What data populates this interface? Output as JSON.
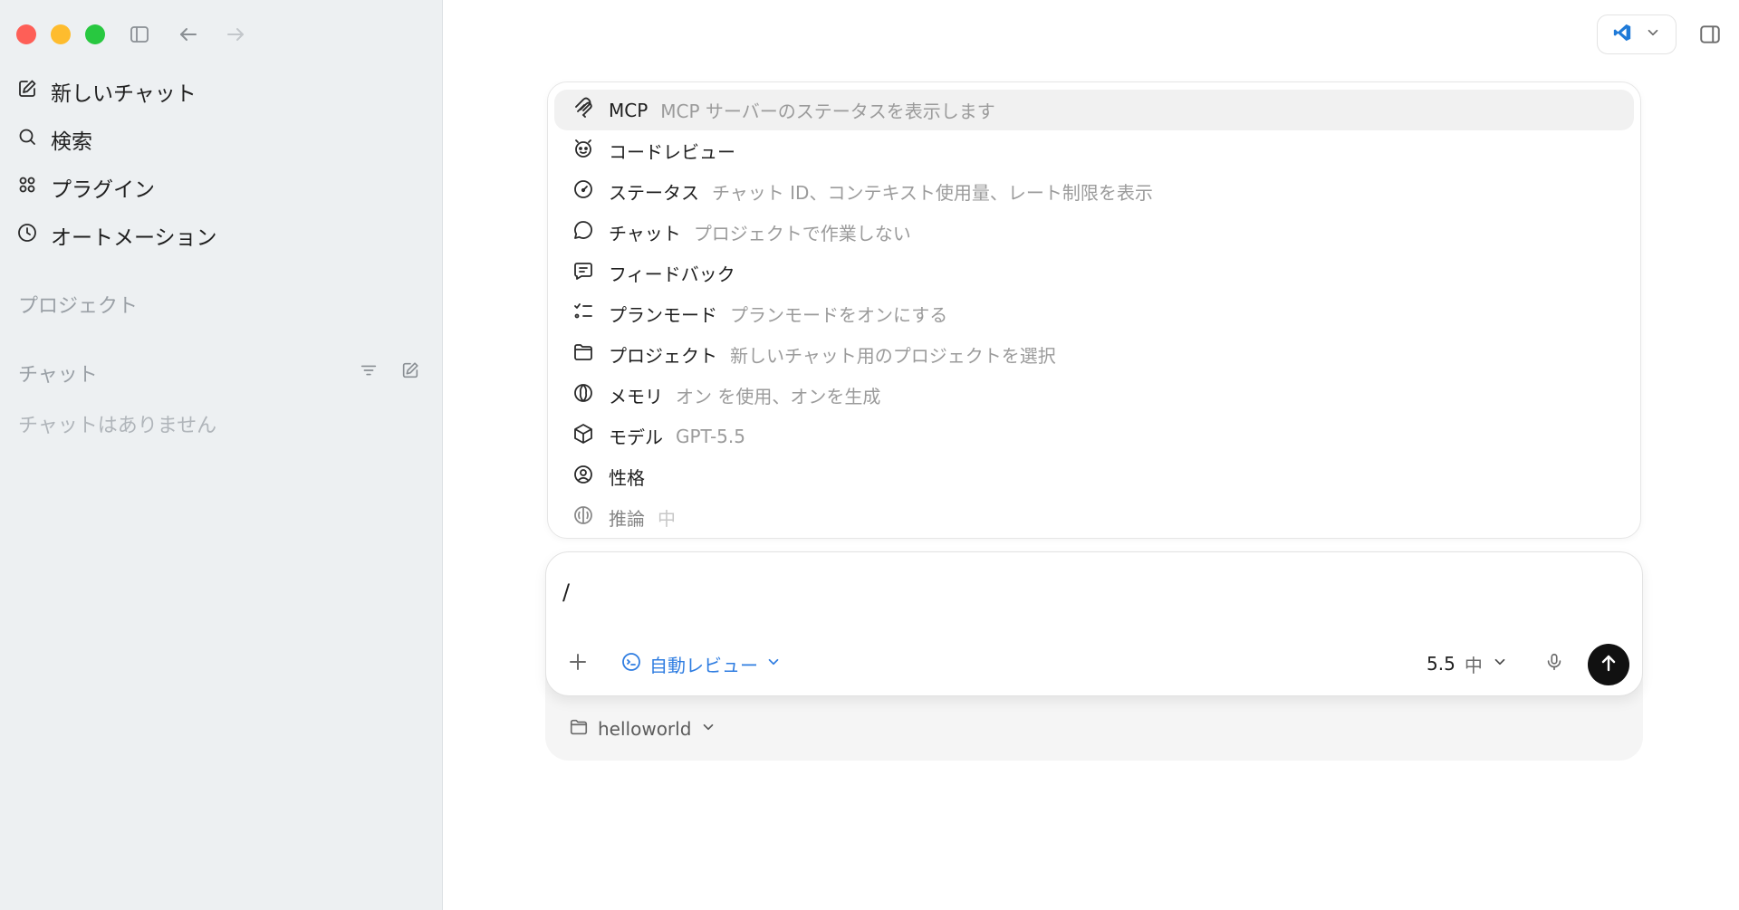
{
  "colors": {
    "sidebar_bg": "#edf0f2",
    "accent_blue": "#2f7de1",
    "traffic_red": "#fe5f57",
    "traffic_yellow": "#febc2e",
    "traffic_green": "#28c840",
    "send_button": "#111111"
  },
  "sidebar": {
    "nav": [
      {
        "label": "新しいチャット",
        "icon": "new-chat-icon"
      },
      {
        "label": "検索",
        "icon": "search-icon"
      },
      {
        "label": "プラグイン",
        "icon": "plugins-icon"
      },
      {
        "label": "オートメーション",
        "icon": "clock-icon"
      }
    ],
    "projects_label": "プロジェクト",
    "chats_label": "チャット",
    "chats_empty": "チャットはありません"
  },
  "header": {
    "editor_icon": "vscode-icon",
    "panel_icon": "panel-toggle-icon"
  },
  "menu": {
    "items": [
      {
        "title": "MCP",
        "desc": "MCP サーバーのステータスを表示します",
        "icon": "mcp-icon",
        "active": true
      },
      {
        "title": "コードレビュー",
        "desc": "",
        "icon": "code-review-icon"
      },
      {
        "title": "ステータス",
        "desc": "チャット ID、コンテキスト使用量、レート制限を表示",
        "icon": "gauge-icon"
      },
      {
        "title": "チャット",
        "desc": "プロジェクトで作業しない",
        "icon": "chat-bubble-icon"
      },
      {
        "title": "フィードバック",
        "desc": "",
        "icon": "feedback-icon"
      },
      {
        "title": "プランモード",
        "desc": "プランモードをオンにする",
        "icon": "checklist-icon"
      },
      {
        "title": "プロジェクト",
        "desc": "新しいチャット用のプロジェクトを選択",
        "icon": "folder-icon"
      },
      {
        "title": "メモリ",
        "desc": "オン を使用、オンを生成",
        "icon": "memory-icon"
      },
      {
        "title": "モデル",
        "desc": "GPT-5.5",
        "icon": "cube-icon"
      },
      {
        "title": "性格",
        "desc": "",
        "icon": "person-icon"
      },
      {
        "title": "推論",
        "desc": "中",
        "icon": "brain-icon"
      }
    ]
  },
  "composer": {
    "value": "/",
    "auto_review_label": "自動レビュー",
    "model_version": "5.5",
    "effort": "中"
  },
  "footer": {
    "folder_name": "helloworld"
  }
}
